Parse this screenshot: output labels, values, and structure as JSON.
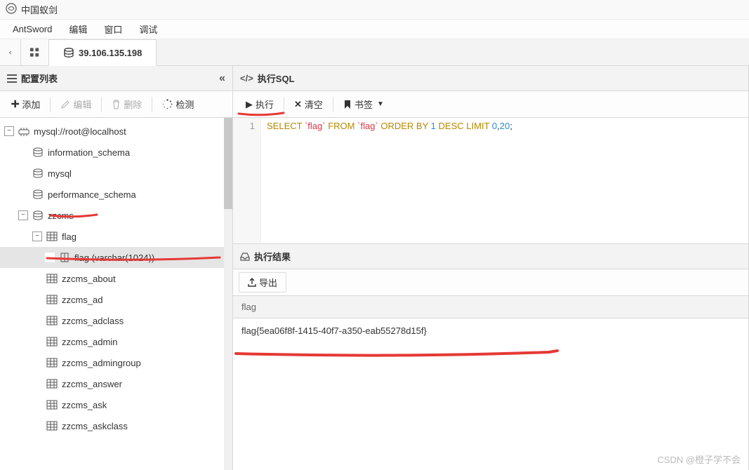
{
  "window": {
    "title": "中国蚁剑"
  },
  "menu": {
    "items": [
      "AntSword",
      "编辑",
      "窗口",
      "调试"
    ]
  },
  "tabs": {
    "connection": "39.106.135.198"
  },
  "sidebar": {
    "header": "配置列表",
    "toolbar": {
      "add": "添加",
      "edit": "编辑",
      "delete": "删除",
      "check": "检测"
    },
    "tree": {
      "root": "mysql://root@localhost",
      "dbs": {
        "info": "information_schema",
        "mysql": "mysql",
        "perf": "performance_schema",
        "zzcms": "zzcms"
      },
      "zzcms_tables": [
        "flag",
        "zzcms_about",
        "zzcms_ad",
        "zzcms_adclass",
        "zzcms_admin",
        "zzcms_admingroup",
        "zzcms_answer",
        "zzcms_ask",
        "zzcms_askclass"
      ],
      "flag_col": "flag (varchar(1024))"
    }
  },
  "sql": {
    "header": "执行SQL",
    "toolbar": {
      "run": "执行",
      "clear": "清空",
      "bookmark": "书签"
    },
    "line": "1",
    "tokens": {
      "select": "SELECT",
      "flag1": "`flag`",
      "from": "FROM",
      "flag2": "`flag`",
      "orderby": "ORDER BY",
      "one": "1",
      "desc": "DESC",
      "limit": "LIMIT",
      "zero": "0",
      "comma": ",",
      "twenty": "20",
      "semi": ";"
    }
  },
  "result": {
    "header": "执行结果",
    "toolbar": {
      "export": "导出"
    },
    "column": "flag",
    "value": "flag{5ea06f8f-1415-40f7-a350-eab55278d15f}"
  },
  "watermark": "CSDN @橙子学不会"
}
